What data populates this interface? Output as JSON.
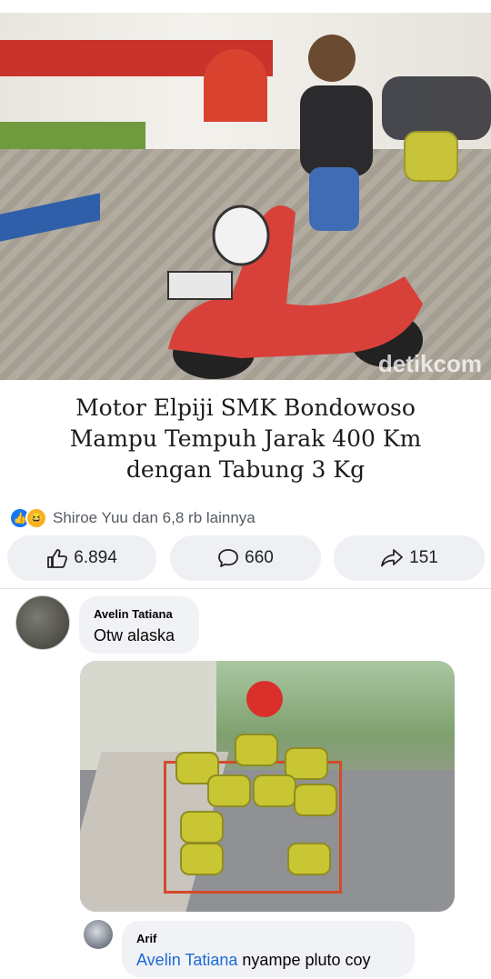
{
  "post": {
    "watermark": "detikcom",
    "headline": [
      "Motor Elpiji SMK Bondowoso",
      "Mampu Tempuh Jarak 400 Km",
      "dengan Tabung 3 Kg"
    ],
    "reactions_text": "Shiroe Yuu dan 6,8 rb lainnya",
    "like_count": "6.894",
    "comment_count": "660",
    "share_count": "151",
    "icons": {
      "like": "thumbs-up-icon",
      "comment": "comment-bubble-icon",
      "share": "share-arrow-icon"
    }
  },
  "comments": [
    {
      "name": "Avelin Tatiana",
      "text": "Otw alaska"
    },
    {
      "name": "Arif",
      "mention": "Avelin Tatiana",
      "text": " nyampe pluto coy"
    }
  ],
  "colors": {
    "accent": "#1877f2",
    "mention": "#1b6bd6",
    "pill_bg": "#eef0f3",
    "bubble_bg": "#f0f2f5"
  }
}
